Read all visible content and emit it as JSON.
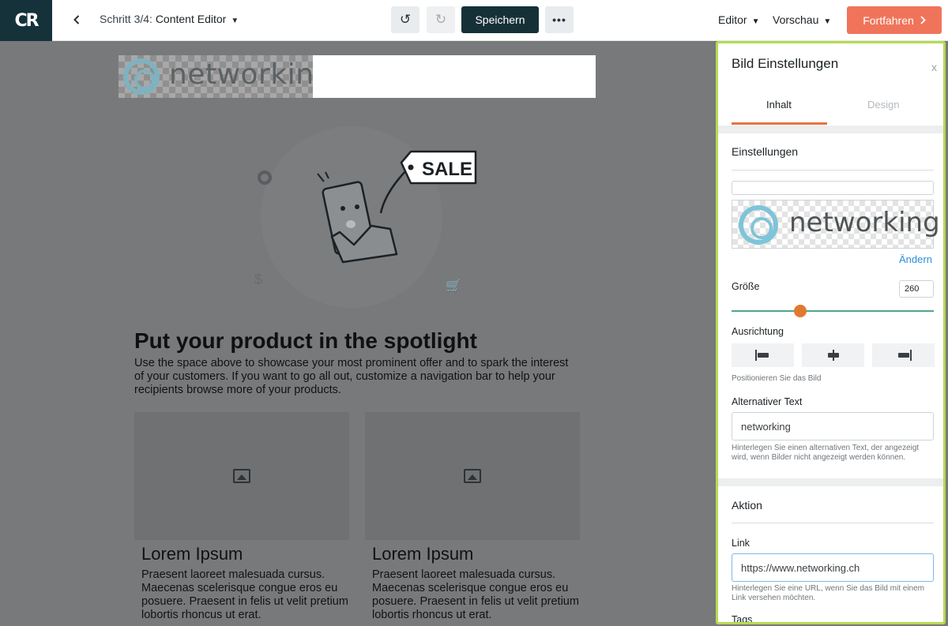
{
  "topbar": {
    "logo_text": "CR",
    "step_prefix": "Schritt 3/4: ",
    "step_name": "Content Editor",
    "undo_icon": "↺",
    "redo_icon": "↻",
    "save_label": "Speichern",
    "more_label": "•••",
    "editor_label": "Editor",
    "preview_label": "Vorschau",
    "continue_label": "Fortfahren"
  },
  "canvas": {
    "logo_word": "networking",
    "sale_tag": "SALE",
    "headline": "Put your product in the spotlight",
    "intro": "Use the space above to showcase your most prominent offer and to spark the interest of your customers. If you want to go all out, customize a navigation bar to help your recipients browse more of your products.",
    "cards": [
      {
        "title": "Lorem Ipsum",
        "text": "Praesent laoreet malesuada cursus. Maecenas scelerisque congue eros eu posuere. Praesent in felis ut velit pretium lobortis rhoncus ut erat."
      },
      {
        "title": "Lorem Ipsum",
        "text": "Praesent laoreet malesuada cursus. Maecenas scelerisque congue eros eu posuere. Praesent in felis ut velit pretium lobortis rhoncus ut erat."
      }
    ]
  },
  "panel": {
    "title": "Bild Einstellungen",
    "close": "x",
    "tabs": [
      {
        "label": "Inhalt",
        "active": true
      },
      {
        "label": "Design",
        "active": false
      }
    ],
    "settings_title": "Einstellungen",
    "preview_word": "networking",
    "change_label": "Ändern",
    "size_label": "Größe",
    "size_value": "260",
    "size_fraction": 0.34,
    "align_label": "Ausrichtung",
    "align_hint": "Positionieren Sie das Bild",
    "alt_label": "Alternativer Text",
    "alt_value": "networking",
    "alt_hint": "Hinterlegen Sie einen alternativen Text, der angezeigt wird, wenn Bilder nicht angezeigt werden können.",
    "action_title": "Aktion",
    "link_label": "Link",
    "link_value": "https://www.networking.ch",
    "link_hint": "Hinterlegen Sie eine URL, wenn Sie das Bild mit einem Link versehen möchten.",
    "tags_label": "Tags"
  },
  "colors": {
    "brand_dark": "#15323a",
    "accent_orange": "#f0745a",
    "panel_border": "#b5db4f",
    "link_blue": "#2d8fd5"
  }
}
